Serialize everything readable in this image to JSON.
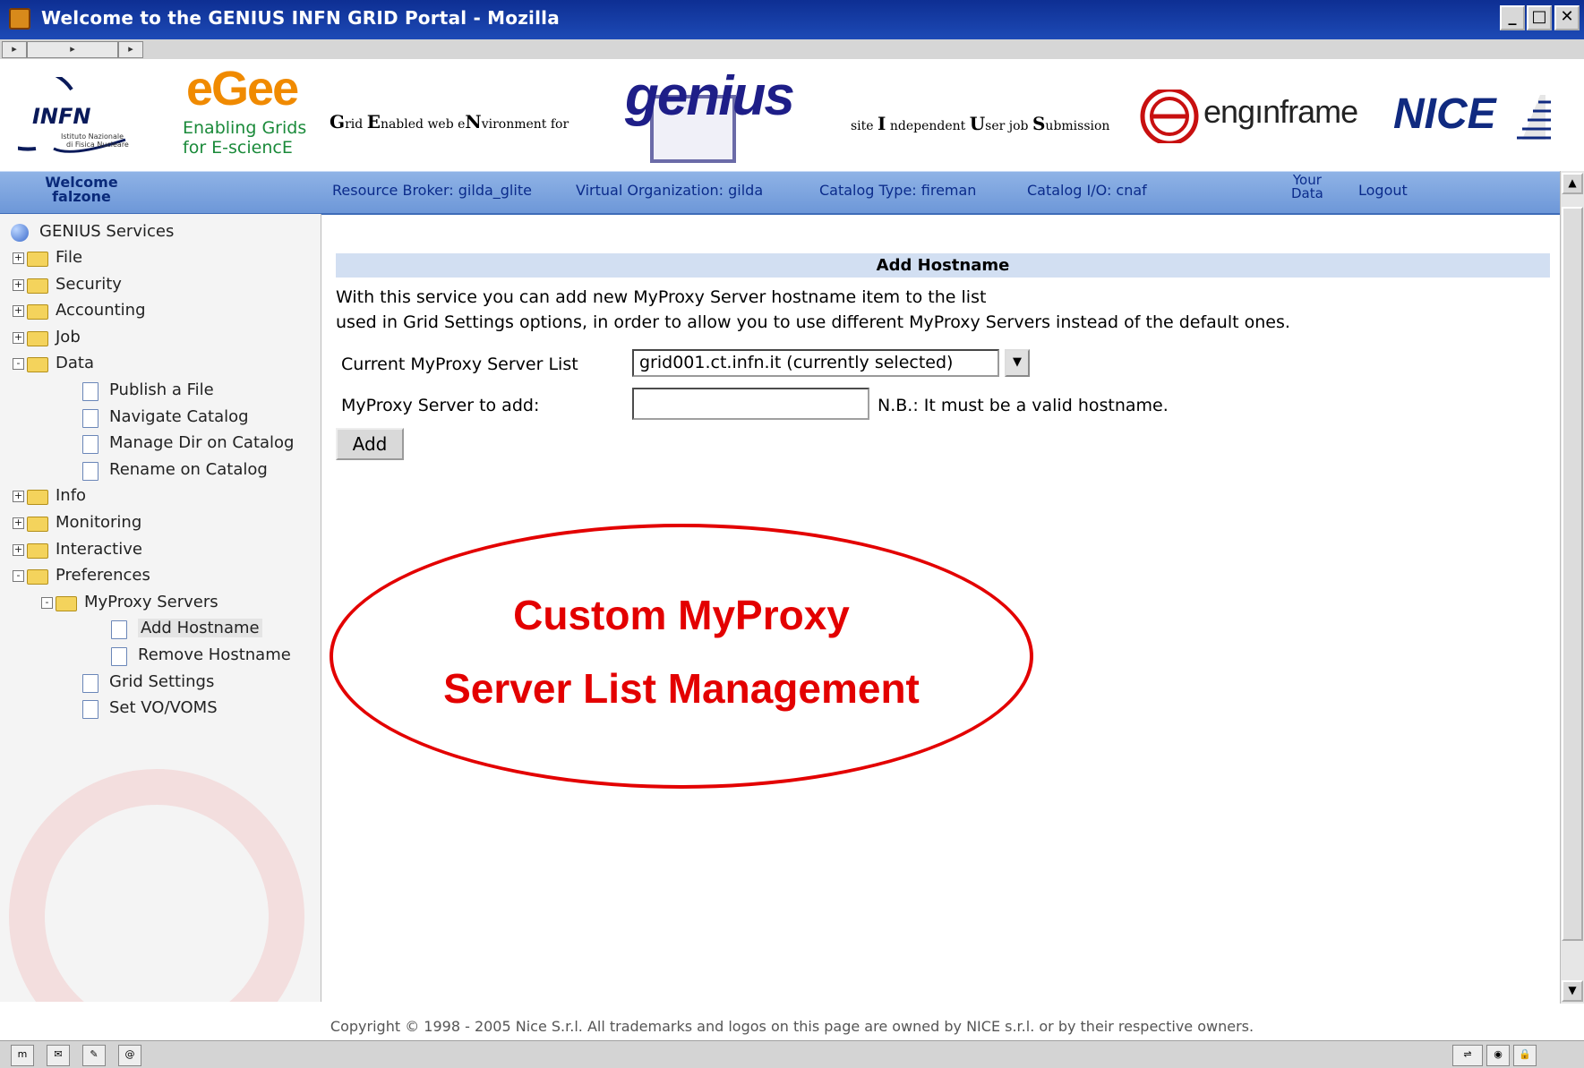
{
  "window": {
    "title": "Welcome to the GENIUS INFN GRID Portal - Mozilla",
    "buttons": [
      "_",
      "□",
      "✕"
    ]
  },
  "header": {
    "infn": {
      "name": "INFN",
      "sub1": "Istituto Nazionale",
      "sub2": "di Fisica Nucleare"
    },
    "egee": {
      "name": "eGee",
      "line1": "Enabling Grids",
      "line2": "for E-sciencE"
    },
    "genius_left": [
      "G",
      "rid ",
      "E",
      "nabled web e",
      "N",
      "vironment for"
    ],
    "genius_logo": "genius",
    "genius_right": [
      "site ",
      "I",
      " ndependent ",
      "U",
      "ser job ",
      "S",
      "ubmission"
    ],
    "enginframe": "engınframe",
    "nice": "NICE"
  },
  "nav": {
    "welcome_line1": "Welcome",
    "welcome_line2": "falzone",
    "resource_broker": "Resource Broker: gilda_glite",
    "vo": "Virtual Organization: gilda",
    "catalog_type": "Catalog Type: fireman",
    "catalog_io": "Catalog I/O: cnaf",
    "your_data_1": "Your",
    "your_data_2": "Data",
    "logout": "Logout"
  },
  "sidebar": {
    "root": "GENIUS Services",
    "items": [
      {
        "label": "File",
        "level": 0,
        "type": "folder",
        "state": "+"
      },
      {
        "label": "Security",
        "level": 0,
        "type": "folder",
        "state": "+"
      },
      {
        "label": "Accounting",
        "level": 0,
        "type": "folder",
        "state": "+"
      },
      {
        "label": "Job",
        "level": 0,
        "type": "folder",
        "state": "+"
      },
      {
        "label": "Data",
        "level": 0,
        "type": "folder",
        "state": "-"
      },
      {
        "label": "Publish a File",
        "level": 1,
        "type": "doc"
      },
      {
        "label": "Navigate Catalog",
        "level": 1,
        "type": "doc"
      },
      {
        "label": "Manage Dir on Catalog",
        "level": 1,
        "type": "doc"
      },
      {
        "label": "Rename on Catalog",
        "level": 1,
        "type": "doc"
      },
      {
        "label": "Info",
        "level": 0,
        "type": "folder",
        "state": "+"
      },
      {
        "label": "Monitoring",
        "level": 0,
        "type": "folder",
        "state": "+"
      },
      {
        "label": "Interactive",
        "level": 0,
        "type": "folder",
        "state": "+"
      },
      {
        "label": "Preferences",
        "level": 0,
        "type": "folder",
        "state": "-"
      },
      {
        "label": "MyProxy Servers",
        "level": 1,
        "type": "folder",
        "state": "-"
      },
      {
        "label": "Add Hostname",
        "level": 2,
        "type": "doc",
        "selected": true
      },
      {
        "label": "Remove Hostname",
        "level": 2,
        "type": "doc"
      },
      {
        "label": "Grid Settings",
        "level": 1,
        "type": "doc"
      },
      {
        "label": "Set VO/VOMS",
        "level": 1,
        "type": "doc"
      }
    ]
  },
  "main": {
    "heading": "Add Hostname",
    "desc1": "With this service you can add new MyProxy Server hostname item to the list",
    "desc2": "used in Grid Settings options, in order to allow you to use different MyProxy Servers instead of the default ones.",
    "list_label": "Current MyProxy Server List",
    "list_value": "grid001.ct.infn.it (currently selected)",
    "add_label": "MyProxy Server to add:",
    "add_value": "",
    "note": "N.B.: It must be a valid hostname.",
    "add_button": "Add"
  },
  "callout": {
    "line1": "Custom MyProxy",
    "line2": "Server List Management",
    "color": "#e30000"
  },
  "footer": {
    "copyright": "Copyright © 1998 - 2005 Nice S.r.l. All trademarks and logos on this page are owned by NICE s.r.l. or by their respective owners."
  },
  "colors": {
    "titlebar": "#1d4ab6",
    "navbar": "#7fa6df",
    "heading_bg": "#d2dff2",
    "accent_red": "#e30000"
  }
}
